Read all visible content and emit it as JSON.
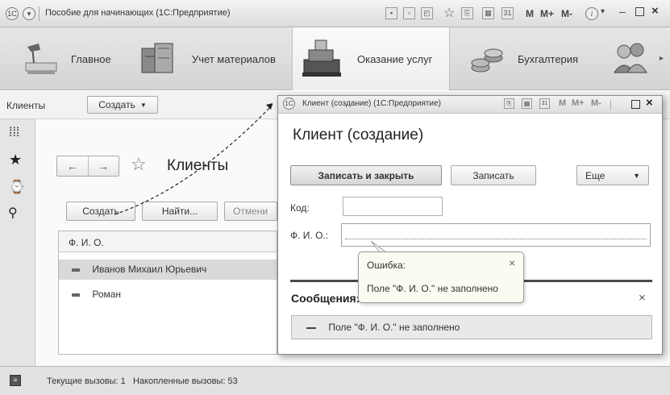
{
  "window": {
    "title": "Пособие для начинающих (1С:Предприятие)",
    "toolbar_labels": {
      "m": "M",
      "m_plus": "M+",
      "m_minus": "M-"
    }
  },
  "sections": [
    {
      "label": "Главное",
      "icon": "desk-lamp-icon"
    },
    {
      "label": "Учет материалов",
      "icon": "crates-icon"
    },
    {
      "label": "Оказание услуг",
      "icon": "cash-register-icon"
    },
    {
      "label": "Бухгалтерия",
      "icon": "coins-icon"
    }
  ],
  "command_bar": {
    "clients_label": "Клиенты",
    "create_label": "Создать"
  },
  "list_form": {
    "title": "Клиенты",
    "buttons": {
      "create": "Создать",
      "find": "Найти...",
      "cancel": "Отмени"
    },
    "column_header": "Ф. И. О.",
    "rows": [
      {
        "name": "Иванов Михаил Юрьевич",
        "selected": true
      },
      {
        "name": "Роман",
        "selected": false
      }
    ]
  },
  "modal": {
    "window_title": "Клиент (создание) (1С:Предприятие)",
    "heading": "Клиент (создание)",
    "buttons": {
      "save_close": "Записать и закрыть",
      "save": "Записать",
      "more": "Еще"
    },
    "fields": {
      "code_label": "Код:",
      "code_value": "",
      "name_label": "Ф. И. О.:",
      "name_value": ""
    },
    "tooltip": {
      "title": "Ошибка:",
      "message": "Поле \"Ф. И. О.\" не заполнено"
    },
    "messages": {
      "header": "Сообщения:",
      "items": [
        "Поле \"Ф. И. О.\" не заполнено"
      ]
    }
  },
  "status": {
    "text": "Текущие вызовы: 1   Накопленные вызовы: 53"
  },
  "colors": {
    "selected_row": "#d9d9d9",
    "accent_dark": "#4a4a4a"
  }
}
